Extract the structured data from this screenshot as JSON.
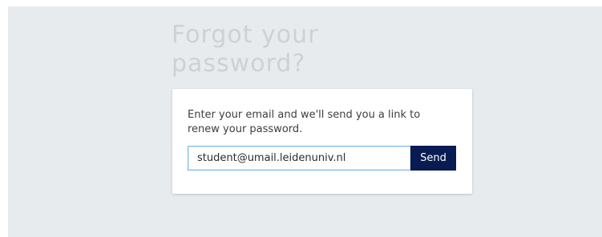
{
  "heading": "Forgot your password?",
  "instructions": "Enter your email and we'll send you a link to renew your password.",
  "email_input": {
    "value": "student@umail.leidenuniv.nl"
  },
  "send_button": {
    "label": "Send"
  },
  "colors": {
    "background": "#e8ebee",
    "heading": "#cdd1d5",
    "button": "#081b52",
    "input_border": "#79b7e8"
  }
}
